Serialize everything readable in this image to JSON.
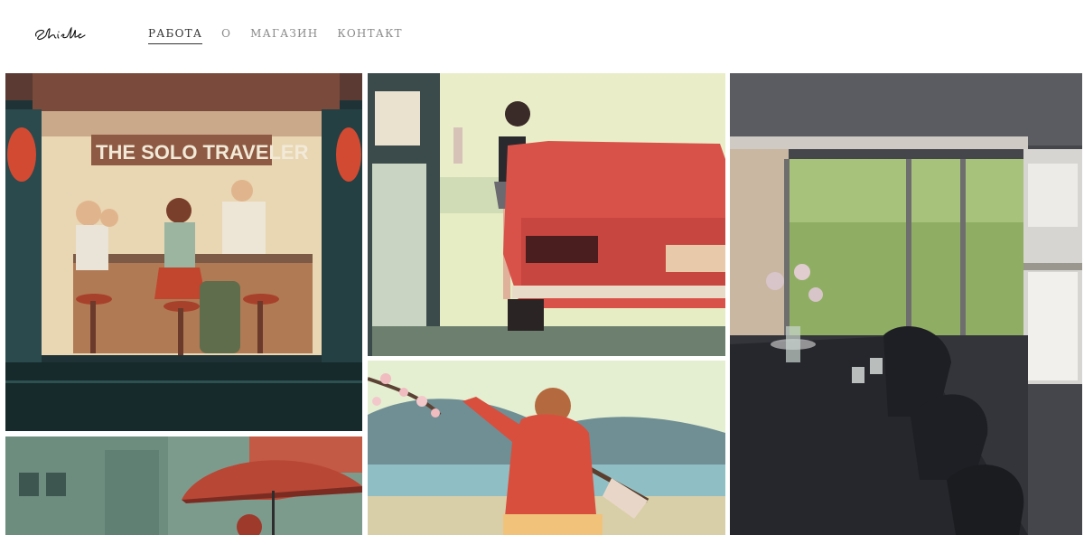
{
  "header": {
    "logo_text": "Shield",
    "nav": [
      {
        "label": "РАБОТА",
        "active": true
      },
      {
        "label": "О",
        "active": false
      },
      {
        "label": "МАГАЗИН",
        "active": false
      },
      {
        "label": "КОНТАКТ",
        "active": false
      }
    ]
  },
  "gallery": {
    "tiles": [
      {
        "sign_text": "THE SOLO TRAVELER"
      },
      {},
      {},
      {},
      {}
    ]
  },
  "colors": {
    "nav_text": "#8a8a8a",
    "nav_active": "#333333",
    "background": "#ffffff"
  }
}
